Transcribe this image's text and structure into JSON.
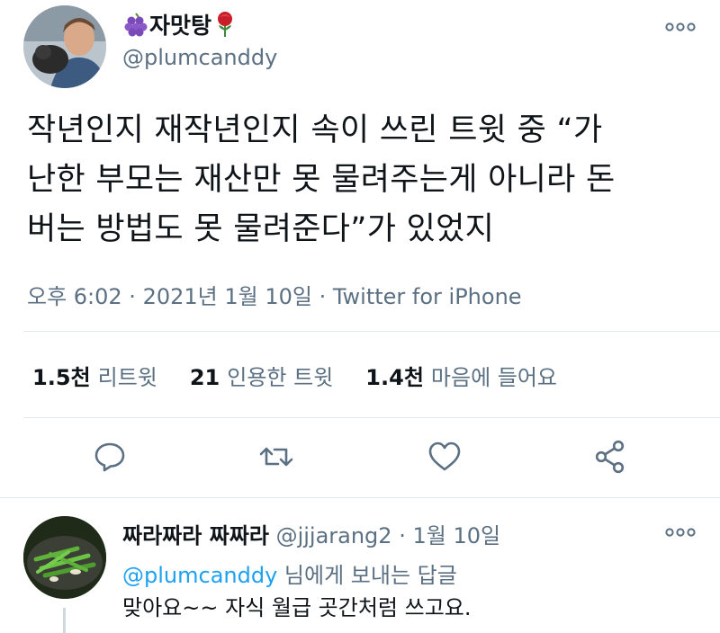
{
  "tweet": {
    "author": {
      "display_name": "자맛탕",
      "handle": "@plumcanddy",
      "avatar_icon": "profile-photo-icon",
      "name_emoji_left": "grapes-icon",
      "name_emoji_right": "rose-icon"
    },
    "body_lines": [
      "작년인지 재작년인지 속이 쓰린 트윗 중 “가",
      "난한 부모는 재산만 못 물려주는게 아니라 돈",
      "버는 방법도 못 물려준다”가 있었지"
    ],
    "meta": "오후 6:02 · 2021년 1월 10일 · Twitter for iPhone",
    "stats": {
      "retweets_count": "1.5천",
      "retweets_label": "리트윗",
      "quotes_count": "21",
      "quotes_label": "인용한 트윗",
      "likes_count": "1.4천",
      "likes_label": "마음에 들어요"
    },
    "actions": [
      "reply-icon",
      "retweet-icon",
      "like-icon",
      "share-icon"
    ]
  },
  "reply": {
    "display_name": "짜라짜라 짜짜라",
    "handle": "@jjjarang2",
    "separator": "·",
    "date": "1월 10일",
    "replying_to_mention": "@plumcanddy",
    "replying_to_suffix": " 님에게 보내는 답글",
    "text": "맞아요~~ 자식 월급 곳간처럼 쓰고요."
  },
  "colors": {
    "text": "#0f1419",
    "secondary": "#5b7083",
    "accent": "#1da1f2",
    "divider": "#e3e8ec"
  }
}
